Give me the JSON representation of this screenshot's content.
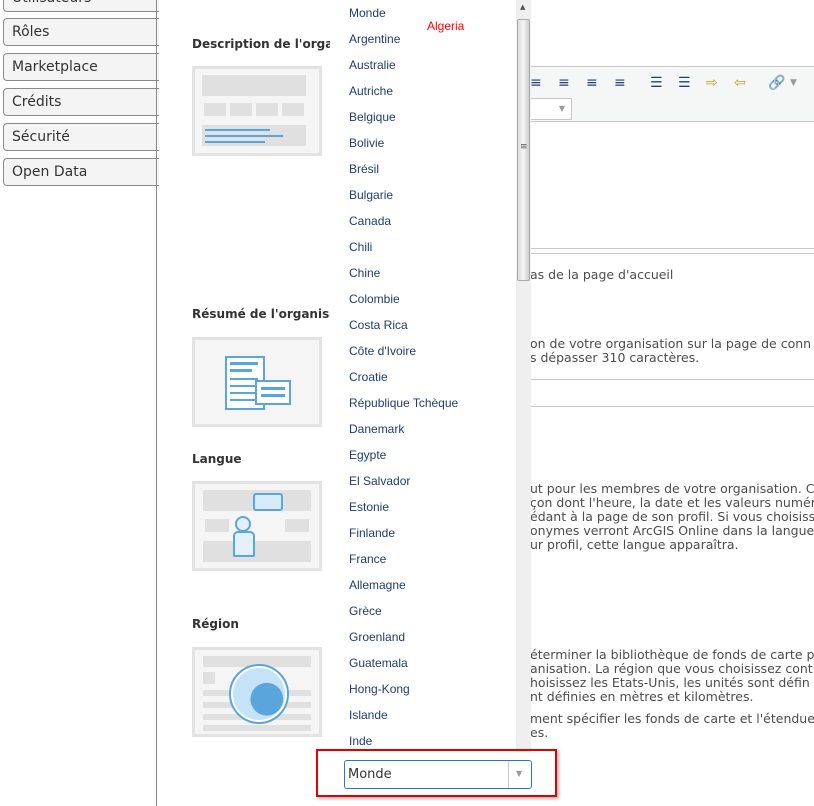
{
  "sidebar": {
    "items": [
      {
        "label": "Utilisateurs"
      },
      {
        "label": "Rôles"
      },
      {
        "label": "Marketplace"
      },
      {
        "label": "Crédits"
      },
      {
        "label": "Sécurité"
      },
      {
        "label": "Open Data"
      }
    ]
  },
  "sections": {
    "description": {
      "heading": "Description de l'organis"
    },
    "summary": {
      "heading": "Résumé de l'organisati",
      "lines": [
        "as de la page d'accueil",
        "on de votre organisation sur la page de conn",
        "s dépasser 310 caractères."
      ]
    },
    "language": {
      "heading": "Langue",
      "lines": [
        "ut pour les membres de votre organisation. C",
        "çon dont l'heure, la date et les valeurs numér",
        "édant à la page de son profil. Si vous choisiss",
        "onymes verront ArcGIS Online dans la langue",
        "ur profil, cette langue apparaîtra."
      ]
    },
    "region": {
      "heading": "Région",
      "lines": [
        "éterminer la bibliothèque de fonds de carte p",
        "anisation. La région que vous choisissez cont",
        "hoisissez les Etats-Unis, les unités sont défin",
        "nt définies en mètres et kilomètres.",
        "",
        "ment spécifier les fonds de carte et l'étendue",
        "es."
      ]
    }
  },
  "tooltip": "Algeria",
  "region_dropdown": {
    "value": "Monde",
    "options": [
      "Monde",
      "Argentine",
      "Australie",
      "Autriche",
      "Belgique",
      "Bolivie",
      "Brésil",
      "Bulgarie",
      "Canada",
      "Chili",
      "Chine",
      "Colombie",
      "Costa Rica",
      "Côte d'Ivoire",
      "Croatie",
      "République Tchèque",
      "Danemark",
      "Egypte",
      "El Salvador",
      "Estonie",
      "Finlande",
      "France",
      "Allemagne",
      "Grèce",
      "Groenland",
      "Guatemala",
      "Hong-Kong",
      "Islande",
      "Inde"
    ]
  },
  "colors": {
    "highlight": "#e00000",
    "accent": "#5aa6dc",
    "tooltip": "#ff0000"
  }
}
